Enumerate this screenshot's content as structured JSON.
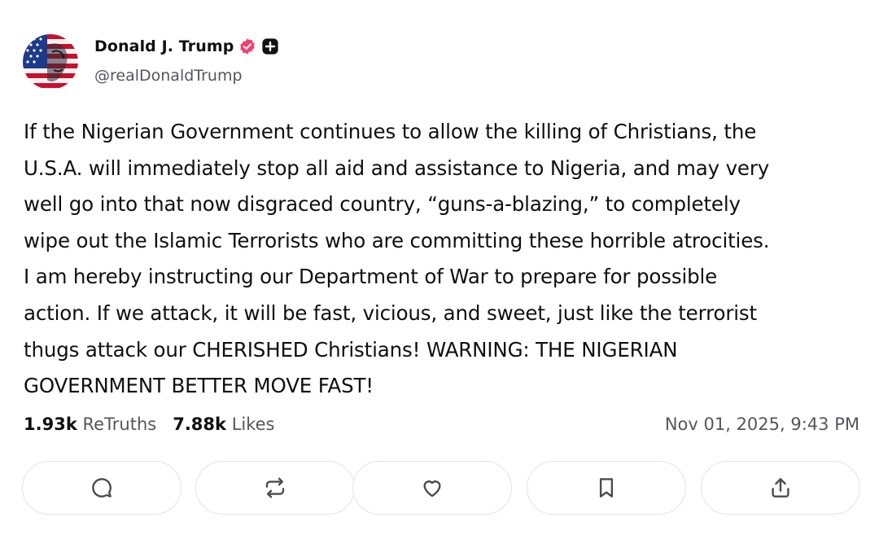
{
  "author": {
    "name": "Donald J. Trump",
    "handle": "@realDonaldTrump",
    "avatar_icon": "american-flag-portrait-avatar",
    "verified_icon": "verified-badge-icon",
    "verified_color": "#f53e6f",
    "plus_badge_icon": "plus-badge-icon"
  },
  "post": {
    "text": "If the Nigerian Government continues to allow the killing of Christians, the\nU.S.A. will immediately stop all aid and assistance to Nigeria, and may very\nwell go into that now disgraced country, “guns-a-blazing,” to completely\nwipe out the Islamic Terrorists who are committing these horrible atrocities.\nI am hereby instructing our Department of War to prepare for possible\naction. If we attack, it will be fast, vicious, and sweet, just like the terrorist\nthugs attack our CHERISHED Christians! WARNING: THE NIGERIAN\nGOVERNMENT BETTER MOVE FAST!"
  },
  "stats": {
    "retruths_count": "1.93k",
    "retruths_label": "ReTruths",
    "likes_count": "7.88k",
    "likes_label": "Likes",
    "timestamp": "Nov 01, 2025, 9:43 PM"
  },
  "actions": [
    {
      "icon": "reply-icon"
    },
    {
      "icon": "retruth-icon"
    },
    {
      "icon": "like-heart-icon"
    },
    {
      "icon": "bookmark-icon"
    },
    {
      "icon": "share-icon"
    }
  ],
  "colors": {
    "text": "#0f0f14",
    "muted": "#55555f",
    "border": "#e3e3e8",
    "icon": "#4a4a54"
  }
}
